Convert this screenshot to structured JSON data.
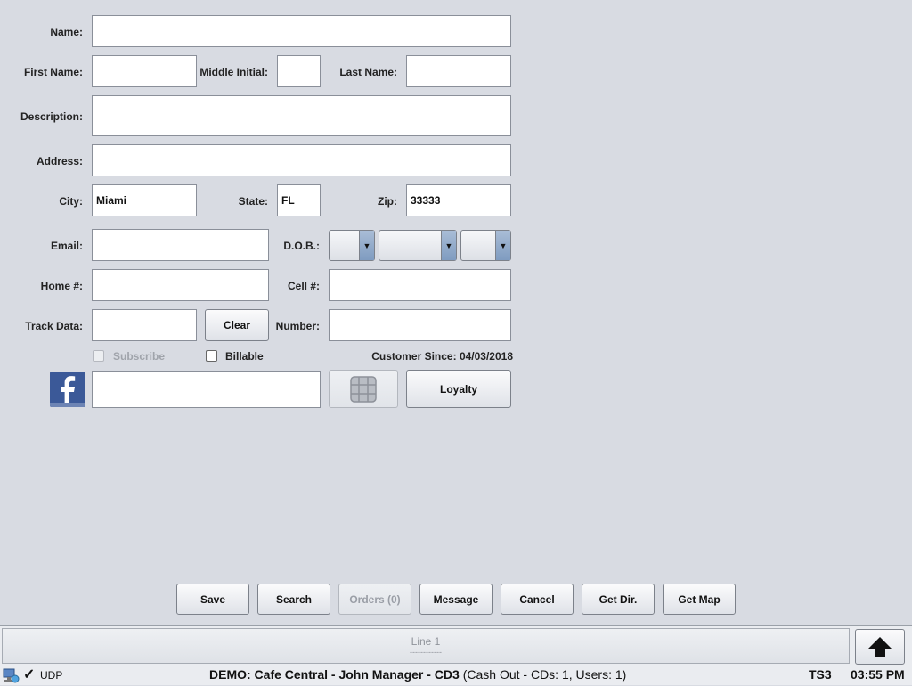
{
  "form": {
    "name_label": "Name:",
    "name_value": "",
    "first_name_label": "First Name:",
    "first_name_value": "",
    "middle_initial_label": "Middle Initial:",
    "middle_initial_value": "",
    "last_name_label": "Last Name:",
    "last_name_value": "",
    "description_label": "Description:",
    "description_value": "",
    "address_label": "Address:",
    "address_value": "",
    "city_label": "City:",
    "city_value": "Miami",
    "state_label": "State:",
    "state_value": "FL",
    "zip_label": "Zip:",
    "zip_value": "33333",
    "email_label": "Email:",
    "email_value": "",
    "dob_label": "D.O.B.:",
    "dob_month": "",
    "dob_day": "",
    "dob_year": "",
    "home_label": "Home #:",
    "home_value": "",
    "cell_label": "Cell #:",
    "cell_value": "",
    "track_label": "Track Data:",
    "track_value": "",
    "clear_label": "Clear",
    "number_label": "Number:",
    "number_value": "",
    "subscribe_label": "Subscribe",
    "billable_label": "Billable",
    "customer_since": "Customer Since: 04/03/2018",
    "facebook_value": "",
    "loyalty_label": "Loyalty"
  },
  "actions": {
    "save": "Save",
    "search": "Search",
    "orders": "Orders (0)",
    "message": "Message",
    "cancel": "Cancel",
    "get_dir": "Get Dir.",
    "get_map": "Get Map"
  },
  "status": {
    "line": "Line 1",
    "line_sub": "------------",
    "udp": "UDP",
    "info_main": "DEMO: Cafe Central - John Manager - CD3",
    "info_extra": "(Cash Out - CDs: 1, Users: 1)",
    "terminal": "TS3",
    "time": "03:55 PM"
  },
  "icons": {
    "facebook": "facebook-icon",
    "chip": "chip-card-icon",
    "home": "home-up-arrow-icon",
    "network": "network-icon",
    "check": "checkmark-icon"
  },
  "colors": {
    "background": "#d8dbe2",
    "facebook_blue": "#3b5998",
    "combo_arrow": "#8fa8c8"
  }
}
